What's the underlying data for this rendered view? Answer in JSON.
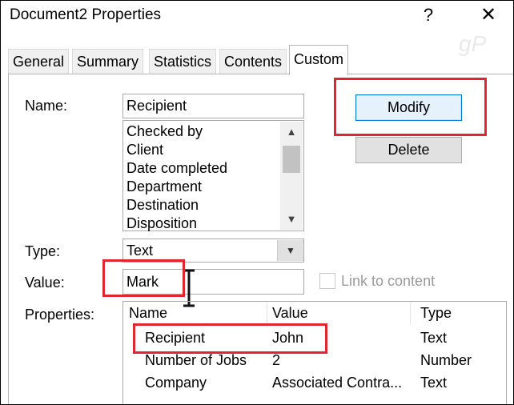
{
  "window": {
    "title": "Document2 Properties",
    "help_icon": "?",
    "close_icon": "✕",
    "watermark": "gP"
  },
  "tabs": [
    {
      "label": "General"
    },
    {
      "label": "Summary"
    },
    {
      "label": "Statistics"
    },
    {
      "label": "Contents"
    },
    {
      "label": "Custom",
      "active": true
    }
  ],
  "form": {
    "name_label": "Name:",
    "name_value": "Recipient",
    "name_options": [
      "Checked by",
      "Client",
      "Date completed",
      "Department",
      "Destination",
      "Disposition"
    ],
    "type_label": "Type:",
    "type_value": "Text",
    "value_label": "Value:",
    "value_value": "Mark",
    "link_to_content_label": "Link to content",
    "link_to_content_checked": false,
    "properties_label": "Properties:"
  },
  "buttons": {
    "modify": "Modify",
    "delete": "Delete"
  },
  "properties_table": {
    "headers": [
      "Name",
      "Value",
      "Type"
    ],
    "rows": [
      [
        "Recipient",
        "John",
        "Text"
      ],
      [
        "Number of Jobs",
        "2",
        "Number"
      ],
      [
        "Company",
        "Associated Contra...",
        "Text"
      ]
    ]
  },
  "annotations": {
    "highlight_color": "#e2262f"
  }
}
